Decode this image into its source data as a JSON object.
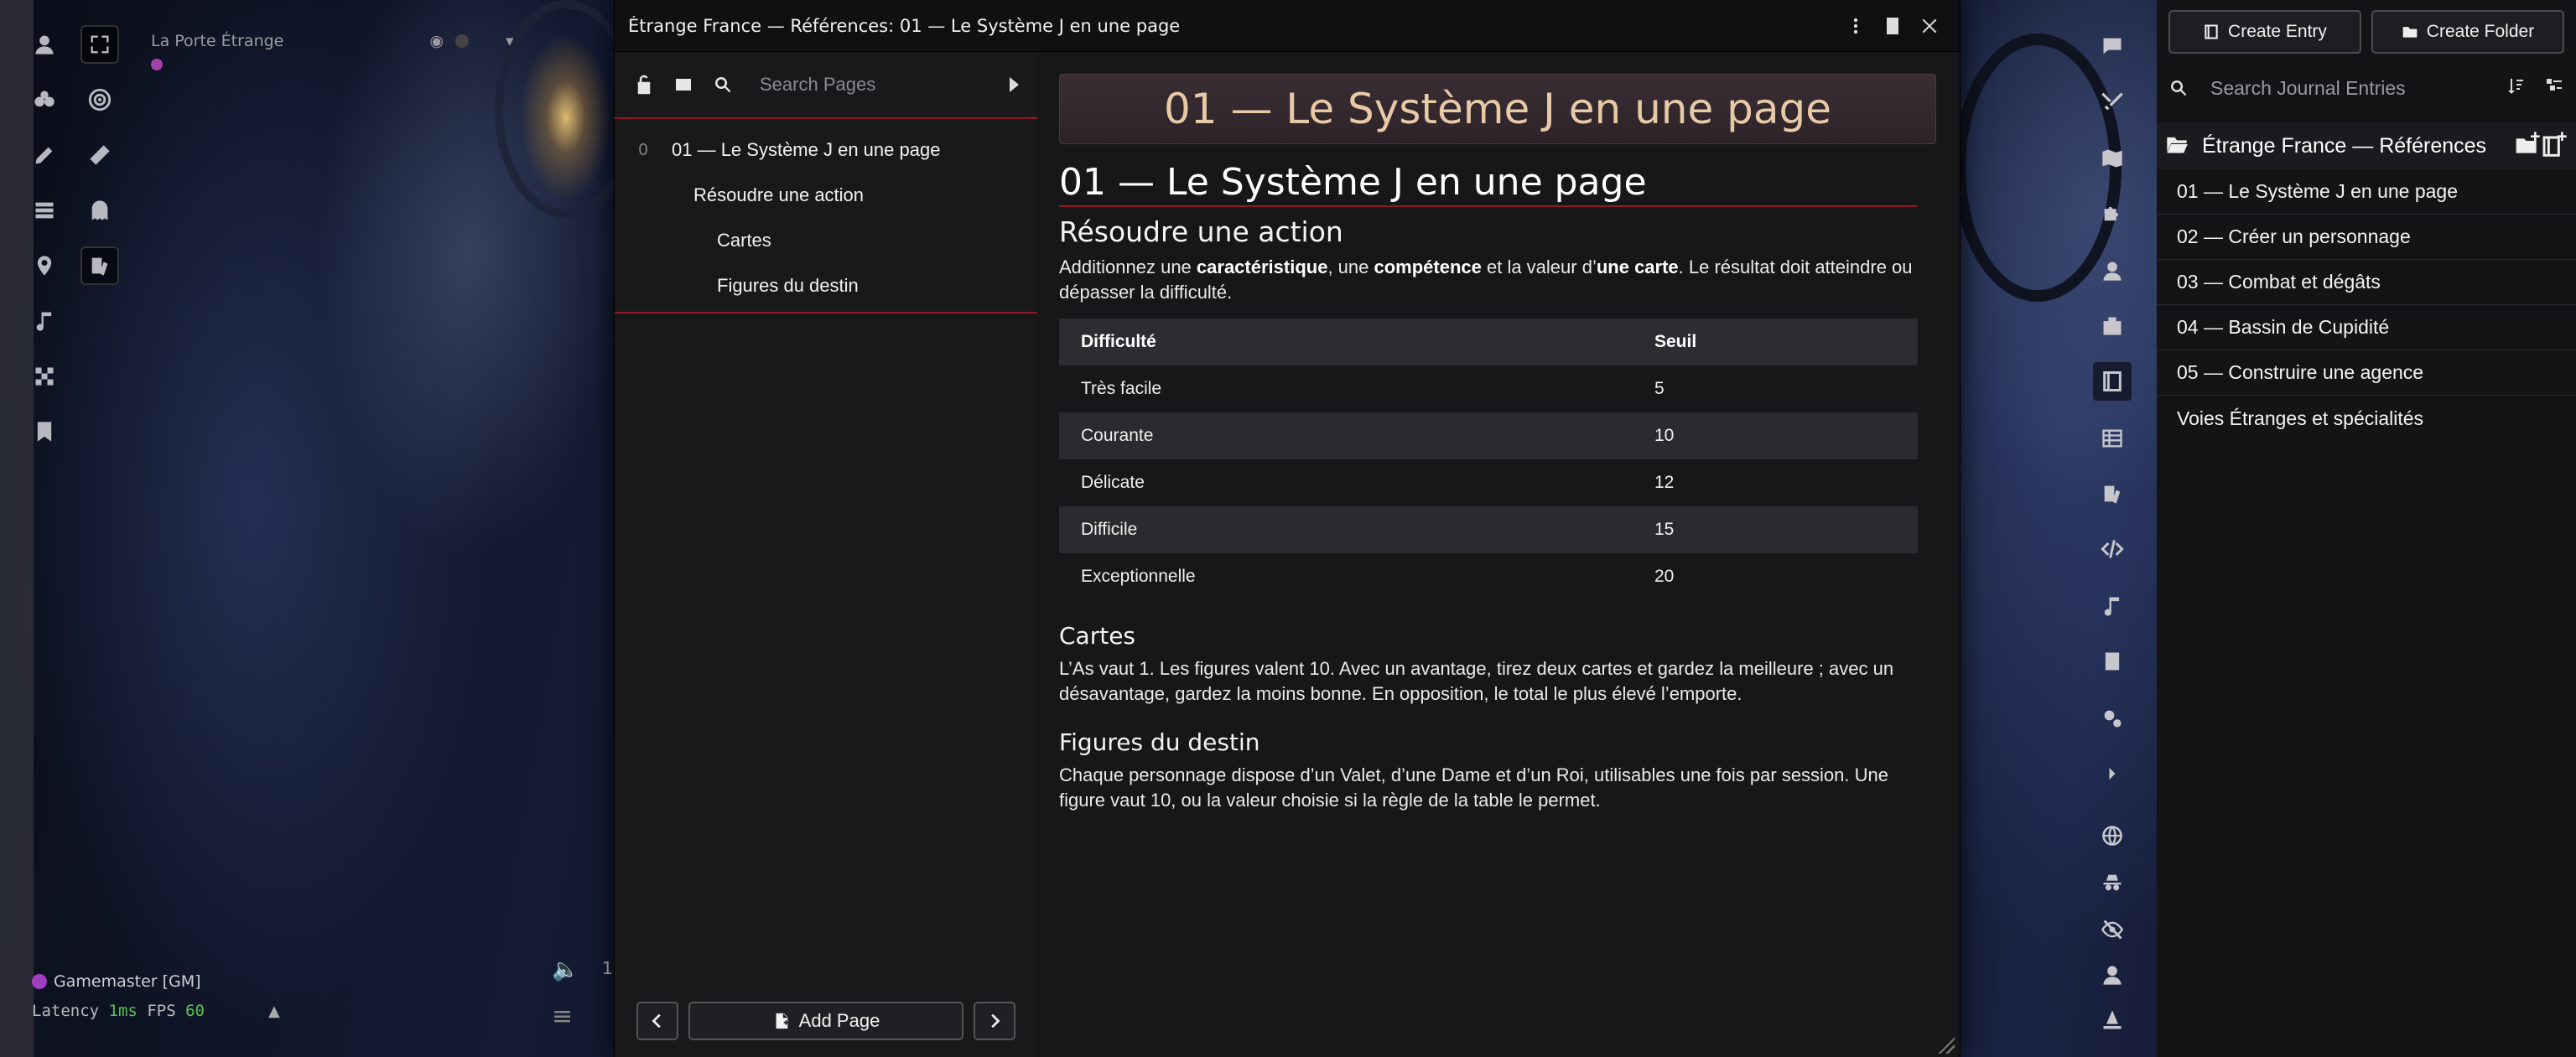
{
  "scene": {
    "name": "La Porte Étrange",
    "gm_badge": "G"
  },
  "players": {
    "label": "Gamemaster [GM]"
  },
  "performance": {
    "latency_label": "Latency",
    "latency_value": "1ms",
    "fps_label": "FPS",
    "fps_value": "60",
    "volume": "1"
  },
  "journal": {
    "window_title": "Étrange France — Références: 01 — Le Système J en une page",
    "pages_search_placeholder": "Search Pages",
    "toc": [
      {
        "num": "0",
        "label": "01 — Le Système J en une page",
        "level": 1
      },
      {
        "num": "",
        "label": "Résoudre une action",
        "level": 2
      },
      {
        "num": "",
        "label": "Cartes",
        "level": 3
      },
      {
        "num": "",
        "label": "Figures du destin",
        "level": 3
      }
    ],
    "add_page_label": "Add Page",
    "banner": "01 — Le Système J en une page",
    "page_heading": "01 — Le Système J en une page",
    "section1": {
      "heading": "Résoudre une action",
      "p_prefix": "Additionnez une ",
      "b1": "caractéristique",
      "p_mid1": ", une ",
      "b2": "compétence",
      "p_mid2": " et la valeur d’",
      "b3": "une carte",
      "p_suffix": ". Le résultat doit atteindre ou dépasser la difficulté."
    },
    "table": {
      "headers": [
        "Difficulté",
        "Seuil"
      ],
      "rows": [
        [
          "Très facile",
          "5"
        ],
        [
          "Courante",
          "10"
        ],
        [
          "Délicate",
          "12"
        ],
        [
          "Difficile",
          "15"
        ],
        [
          "Exceptionnelle",
          "20"
        ]
      ]
    },
    "section2": {
      "heading": "Cartes",
      "text": "L’As vaut 1. Les figures valent 10. Avec un avantage, tirez deux cartes et gardez la meilleure ; avec un désavantage, gardez la moins bonne. En opposition, le total le plus élevé l’emporte."
    },
    "section3": {
      "heading": "Figures du destin",
      "text": "Chaque personnage dispose d’un Valet, d’une Dame et d’un Roi, utilisables une fois par session. Une figure vaut 10, ou la valeur choisie si la règle de la table le permet."
    }
  },
  "directory": {
    "create_entry_label": "Create Entry",
    "create_folder_label": "Create Folder",
    "search_placeholder": "Search Journal Entries",
    "folder_name": "Étrange France — Références",
    "entries": [
      "01 — Le Système J en une page",
      "02 — Créer un personnage",
      "03 — Combat et dégâts",
      "04 — Bassin de Cupidité",
      "05 — Construire une agence",
      "Voies Étranges et spécialités"
    ]
  },
  "colors": {
    "accent": "#8c1c2a",
    "banner_text": "#e8c9a6",
    "fps_green": "#58c24f",
    "gm_purple": "#a13ec0"
  }
}
